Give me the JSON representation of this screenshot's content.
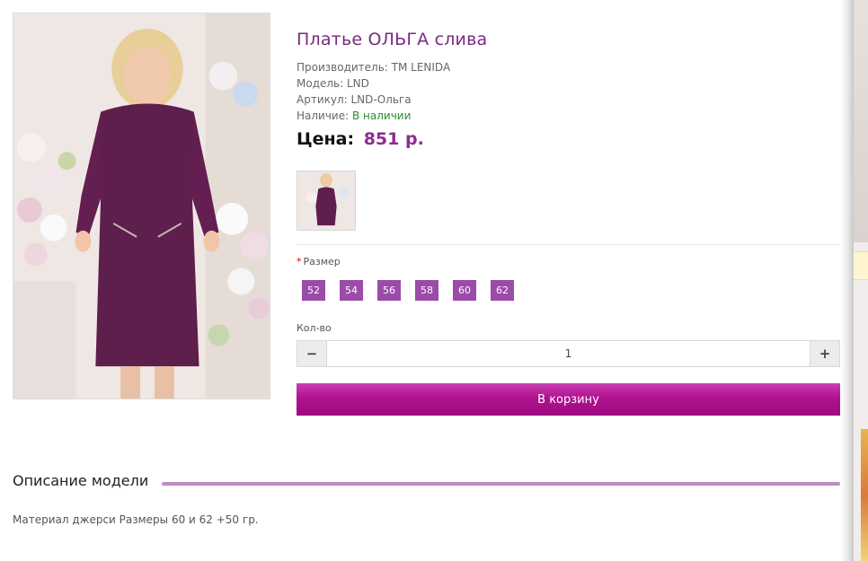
{
  "product": {
    "title": "Платье ОЛЬГА слива",
    "manufacturer": "Производитель: ТМ LENIDA",
    "model": "Модель: LND",
    "sku": "Артикул: LND-Ольга",
    "availability_label": "Наличие:",
    "availability_value": "В наличии",
    "price_label": "Цена:",
    "price_value": "851 р."
  },
  "options": {
    "size_required_mark": "*",
    "size_label": "Размер",
    "sizes": [
      "52",
      "54",
      "56",
      "58",
      "60",
      "62"
    ]
  },
  "quantity": {
    "label": "Кол-во",
    "value": "1",
    "minus_icon": "minus-icon",
    "plus_icon": "plus-icon"
  },
  "cart": {
    "button_label": "В корзину"
  },
  "description": {
    "heading": "Описание модели",
    "text": "Материал джерси Размеры 60 и 62 +50 гр."
  },
  "colors": {
    "title": "#7a2a7e",
    "price": "#8a2d8e",
    "size_button": "#9b4ba8",
    "cart_button": "#b0128f",
    "in_stock": "#2e8b2e",
    "section_line": "#c08bc7"
  }
}
